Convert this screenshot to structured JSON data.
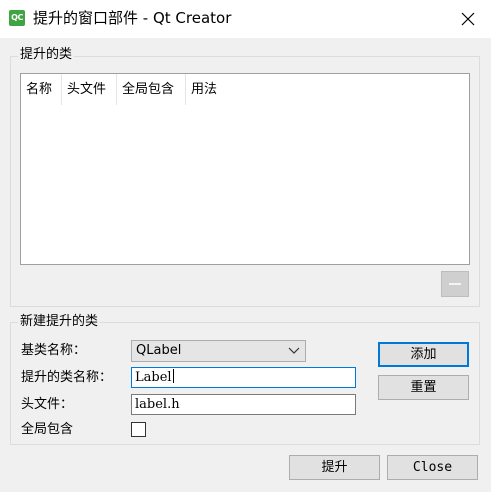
{
  "window": {
    "app_icon_text": "QC",
    "title": "提升的窗口部件 - Qt Creator"
  },
  "promoted_group": {
    "label": "提升的类",
    "columns": [
      "名称",
      "头文件",
      "全局包含",
      "用法"
    ],
    "rows": []
  },
  "new_group": {
    "label": "新建提升的类",
    "base_class_label": "基类名称：",
    "base_class_value": "QLabel",
    "promoted_class_label": "提升的类名称：",
    "promoted_class_value": "Label",
    "header_file_label": "头文件：",
    "header_file_value": "label.h",
    "global_include_label": "全局包含",
    "global_include_checked": false,
    "add_label": "添加",
    "reset_label": "重置"
  },
  "footer": {
    "promote_label": "提升",
    "close_label": "Close"
  },
  "icons": {
    "app": "qt-creator-icon",
    "close": "close-icon",
    "combo": "chevron-down-icon",
    "remove": "minus-icon"
  }
}
